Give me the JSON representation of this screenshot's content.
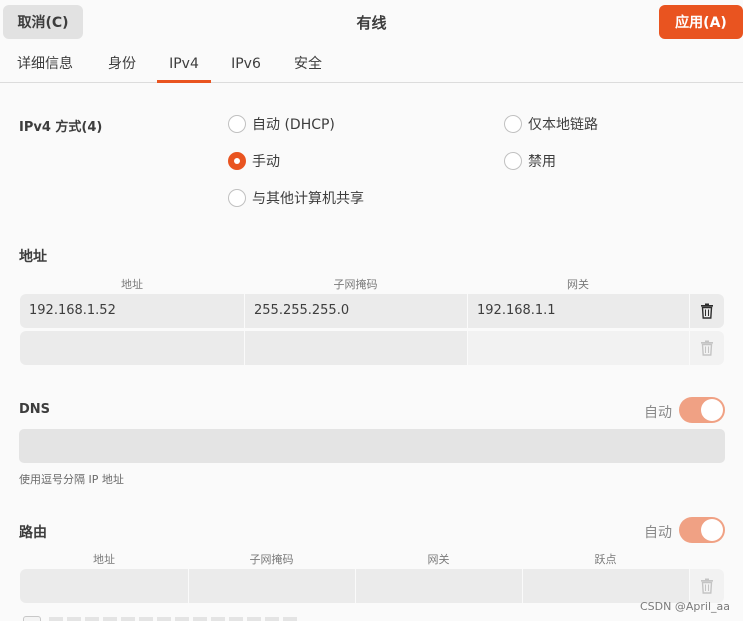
{
  "header": {
    "cancel_label": "取消(C)",
    "title": "有线",
    "apply_label": "应用(A)"
  },
  "tabs": [
    {
      "label": "详细信息"
    },
    {
      "label": "身份"
    },
    {
      "label": "IPv4",
      "active": true
    },
    {
      "label": "IPv6"
    },
    {
      "label": "安全"
    }
  ],
  "ipv4_method": {
    "label": "IPv4 方式(4)",
    "options": [
      {
        "label": "自动 (DHCP)",
        "selected": false
      },
      {
        "label": "手动",
        "selected": true
      },
      {
        "label": "与其他计算机共享",
        "selected": false
      },
      {
        "label": "仅本地链路",
        "selected": false
      },
      {
        "label": "禁用",
        "selected": false
      }
    ]
  },
  "addresses": {
    "title": "地址",
    "columns": [
      "地址",
      "子网掩码",
      "网关"
    ],
    "rows": [
      [
        "192.168.1.52",
        "255.255.255.0",
        "192.168.1.1"
      ],
      [
        "",
        "",
        ""
      ]
    ]
  },
  "dns": {
    "title": "DNS",
    "auto_label": "自动",
    "auto_on": true,
    "value": "",
    "hint": "使用逗号分隔 IP 地址"
  },
  "routes": {
    "title": "路由",
    "auto_label": "自动",
    "auto_on": true,
    "columns": [
      "地址",
      "子网掩码",
      "网关",
      "跃点"
    ],
    "rows": [
      [
        "",
        "",
        "",
        ""
      ]
    ]
  },
  "watermark": "CSDN @April_aa",
  "colors": {
    "accent": "#e95420",
    "switch_on": "#f0a184"
  },
  "icons": {
    "delete": "trash-icon"
  }
}
